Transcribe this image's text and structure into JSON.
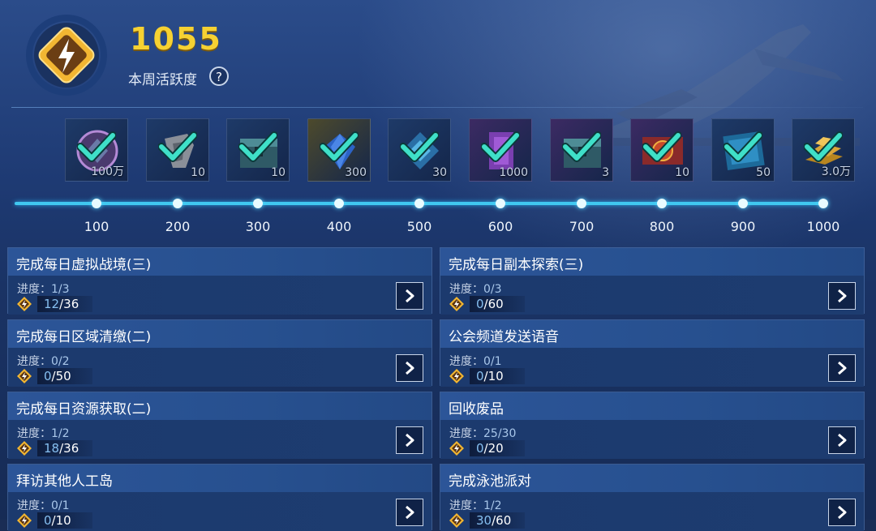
{
  "header": {
    "score": "1055",
    "score_label": "本周活跃度",
    "help_label": "?"
  },
  "rewards": [
    {
      "qty": "100万",
      "icon": "badge-icon",
      "bg": "#1e3a68",
      "claimed": true
    },
    {
      "qty": "10",
      "icon": "metal-part-icon",
      "bg": "#1e3a68",
      "claimed": true
    },
    {
      "qty": "10",
      "icon": "chest-icon",
      "bg": "#1e3a68",
      "claimed": true
    },
    {
      "qty": "300",
      "icon": "gem-icon",
      "bg": "#4d4a2c",
      "claimed": true
    },
    {
      "qty": "30",
      "icon": "blueprint-chip-icon",
      "bg": "#1e3a68",
      "claimed": true
    },
    {
      "qty": "1000",
      "icon": "purple-card-icon",
      "bg": "#3c2a63",
      "claimed": true
    },
    {
      "qty": "3",
      "icon": "chest-icon",
      "bg": "#3c2a63",
      "claimed": true
    },
    {
      "qty": "10",
      "icon": "coupon-icon",
      "bg": "#3c2a63",
      "claimed": true
    },
    {
      "qty": "50",
      "icon": "blueprint-icon",
      "bg": "#1e3a68",
      "claimed": true
    },
    {
      "qty": "3.0万",
      "icon": "gold-bars-icon",
      "bg": "#1e3a68",
      "claimed": true
    }
  ],
  "milestones": [
    "100",
    "200",
    "300",
    "400",
    "500",
    "600",
    "700",
    "800",
    "900",
    "1000"
  ],
  "progress_label": "进度：",
  "tasks": [
    {
      "title": "完成每日虚拟战境(三)",
      "progress": "1/3",
      "points_cur": "12",
      "points_max": "/36"
    },
    {
      "title": "完成每日副本探索(三)",
      "progress": "0/3",
      "points_cur": "0",
      "points_max": "/60"
    },
    {
      "title": "完成每日区域清缴(二)",
      "progress": "0/2",
      "points_cur": "0",
      "points_max": "/50"
    },
    {
      "title": "公会频道发送语音",
      "progress": "0/1",
      "points_cur": "0",
      "points_max": "/10"
    },
    {
      "title": "完成每日资源获取(二)",
      "progress": "1/2",
      "points_cur": "18",
      "points_max": "/36"
    },
    {
      "title": "回收废品",
      "progress": "25/30",
      "points_cur": "0",
      "points_max": "/20"
    },
    {
      "title": "拜访其他人工岛",
      "progress": "0/1",
      "points_cur": "0",
      "points_max": "/10"
    },
    {
      "title": "完成泳池派对",
      "progress": "1/2",
      "points_cur": "30",
      "points_max": "/60"
    }
  ],
  "colors": {
    "score": "#f6d132",
    "track": "#40c8f0",
    "check": "#3fe0c8",
    "bolt": "#f2b632"
  }
}
